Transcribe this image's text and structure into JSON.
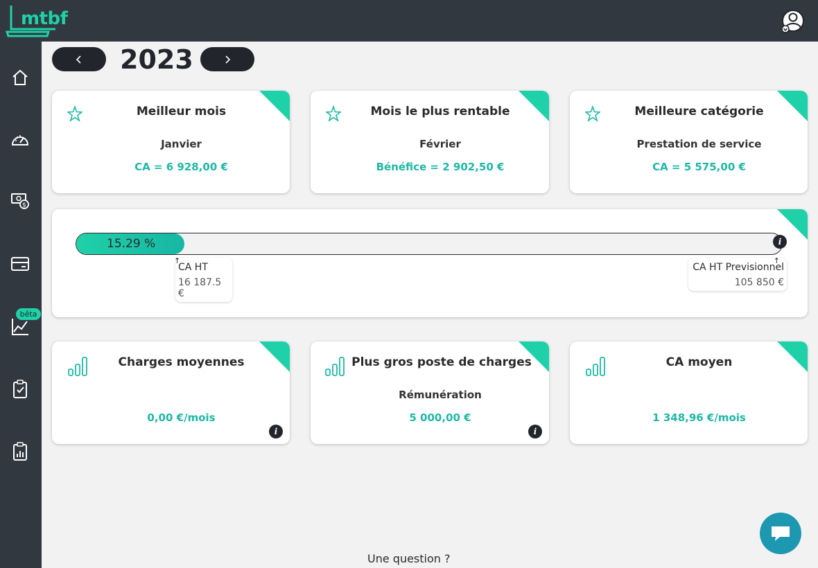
{
  "header": {
    "logo_text": "mtbf",
    "user_icon": "user-account-icon"
  },
  "sidebar": {
    "items": [
      {
        "icon": "home-icon"
      },
      {
        "icon": "dashboard-gauge-icon"
      },
      {
        "icon": "money-icon"
      },
      {
        "icon": "credit-card-icon"
      },
      {
        "icon": "line-chart-icon",
        "badge": "bêta"
      },
      {
        "icon": "clipboard-check-icon"
      },
      {
        "icon": "clipboard-chart-icon"
      }
    ]
  },
  "year_nav": {
    "year": "2023"
  },
  "stats_top": [
    {
      "title": "Meilleur mois",
      "subtitle": "Janvier",
      "value": "CA = 6 928,00 €",
      "icon": "star-icon"
    },
    {
      "title": "Mois le plus rentable",
      "subtitle": "Février",
      "value": "Bénéfice = 2 902,50 €",
      "icon": "star-icon"
    },
    {
      "title": "Meilleure catégorie",
      "subtitle": "Prestation de service",
      "value": "CA = 5 575,00 €",
      "icon": "star-icon"
    }
  ],
  "progress": {
    "percent_label": "15.29 %",
    "fraction": 0.1529,
    "current_label": "CA HT",
    "current_value": "16 187.5 €",
    "target_label": "CA HT Previsionnel",
    "target_value": "105 850 €"
  },
  "stats_bottom": [
    {
      "title": "Charges moyennes",
      "subtitle": "",
      "value": "0,00 €/mois",
      "icon": "bar-chart-icon",
      "info": true
    },
    {
      "title": "Plus gros poste de charges",
      "subtitle": "Rémunération",
      "value": "5 000,00 €",
      "icon": "bar-chart-icon",
      "info": true
    },
    {
      "title": "CA moyen",
      "subtitle": "",
      "value": "1 348,96 €/mois",
      "icon": "bar-chart-icon",
      "info": false
    }
  ],
  "footer": {
    "question": "Une question ?"
  },
  "colors": {
    "accent": "#1fd1a8",
    "value_text": "#1fb7a6",
    "dark": "#32383f",
    "chat": "#1d98b0"
  }
}
